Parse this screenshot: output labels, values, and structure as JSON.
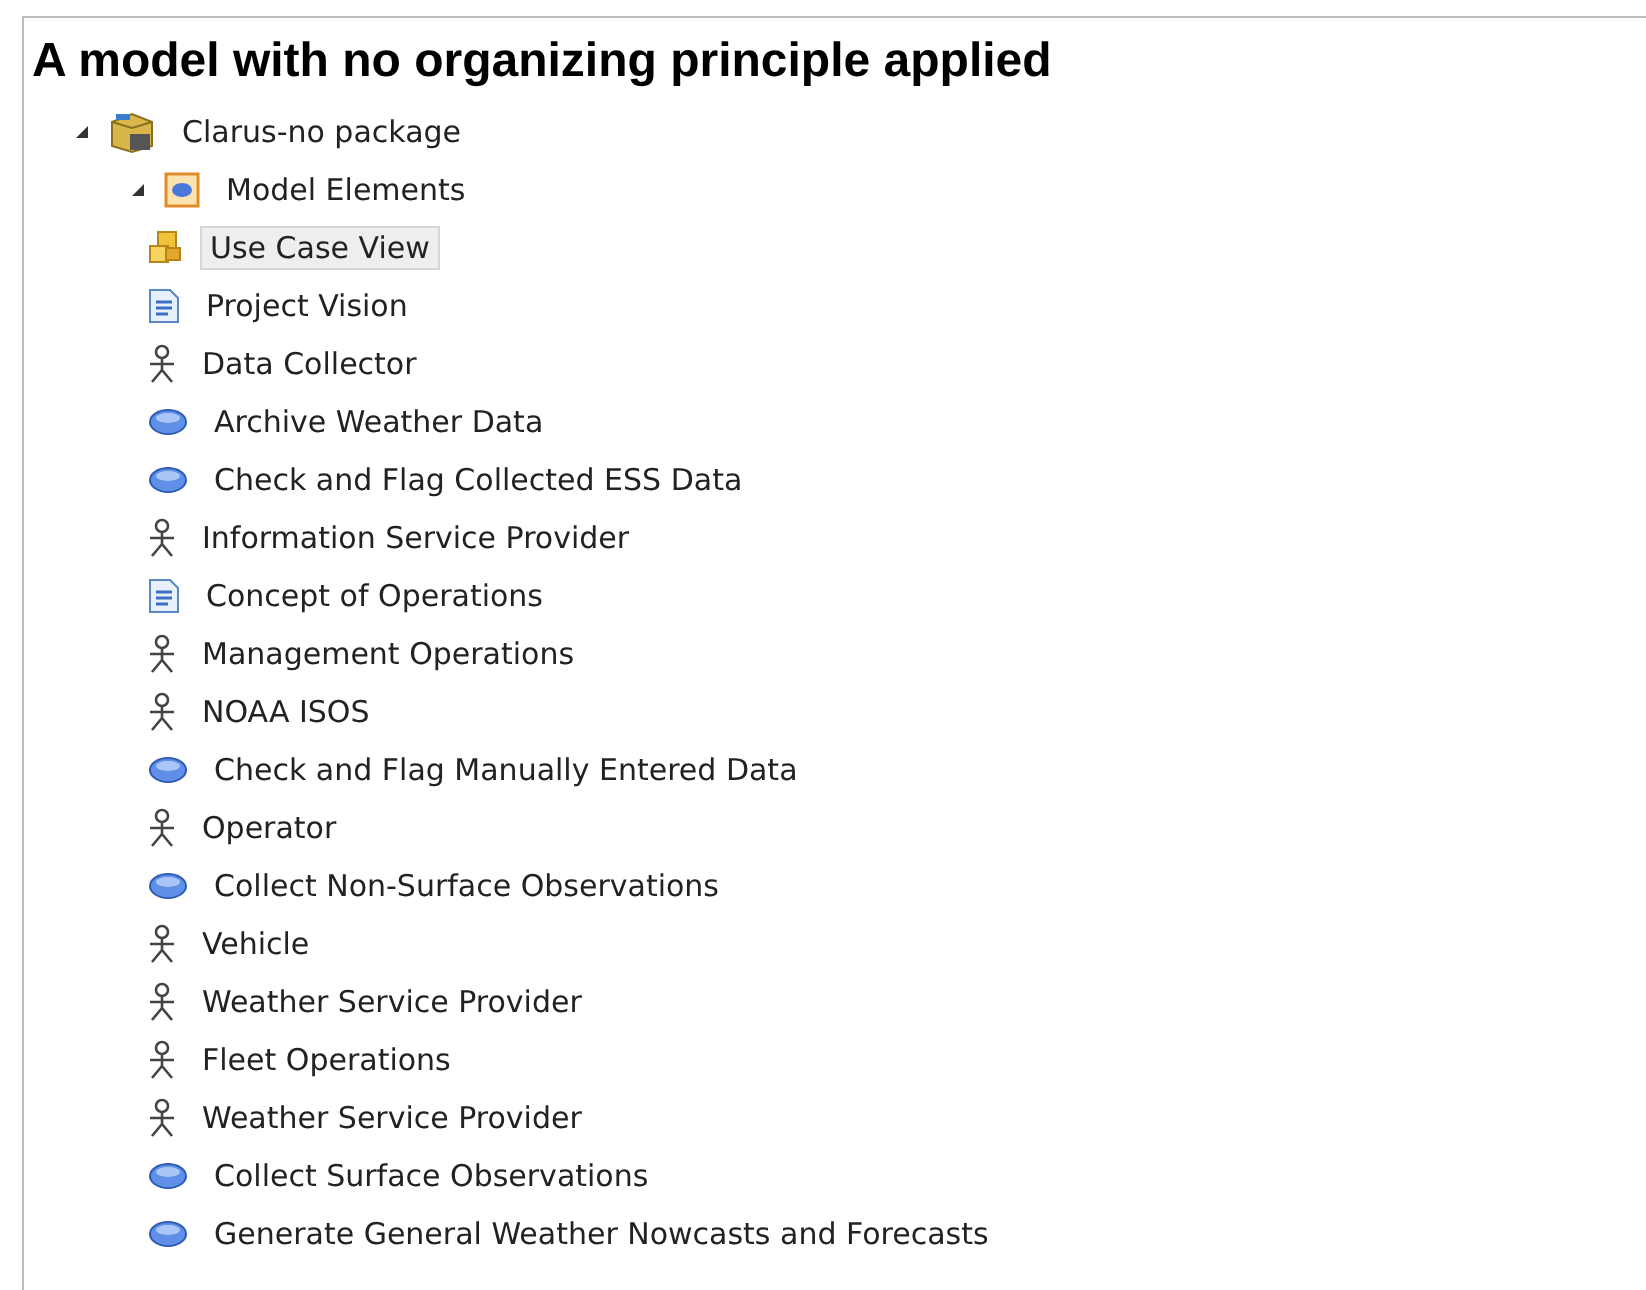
{
  "title": "A model with no organizing principle applied",
  "tree": [
    {
      "label": "Clarus-no package",
      "kind": "package",
      "expanded": true,
      "selected": false,
      "children": [
        {
          "label": "Model Elements",
          "kind": "model",
          "expanded": true,
          "selected": false,
          "children": [
            {
              "label": "Use Case View",
              "kind": "view",
              "selected": true
            },
            {
              "label": "Project Vision",
              "kind": "document",
              "selected": false
            },
            {
              "label": "Data Collector",
              "kind": "actor",
              "selected": false
            },
            {
              "label": "Archive Weather Data",
              "kind": "usecase",
              "selected": false
            },
            {
              "label": "Check and Flag Collected ESS Data",
              "kind": "usecase",
              "selected": false
            },
            {
              "label": "Information Service Provider",
              "kind": "actor",
              "selected": false
            },
            {
              "label": "Concept of Operations",
              "kind": "document",
              "selected": false
            },
            {
              "label": "Management Operations",
              "kind": "actor",
              "selected": false
            },
            {
              "label": "NOAA ISOS",
              "kind": "actor",
              "selected": false
            },
            {
              "label": "Check and Flag Manually Entered Data",
              "kind": "usecase",
              "selected": false
            },
            {
              "label": "Operator",
              "kind": "actor",
              "selected": false
            },
            {
              "label": "Collect Non-Surface Observations",
              "kind": "usecase",
              "selected": false
            },
            {
              "label": "Vehicle",
              "kind": "actor",
              "selected": false
            },
            {
              "label": "Weather Service Provider",
              "kind": "actor",
              "selected": false
            },
            {
              "label": "Fleet Operations",
              "kind": "actor",
              "selected": false
            },
            {
              "label": "Weather Service Provider",
              "kind": "actor",
              "selected": false
            },
            {
              "label": "Collect Surface Observations",
              "kind": "usecase",
              "selected": false
            },
            {
              "label": "Generate General Weather Nowcasts and Forecasts",
              "kind": "usecase",
              "selected": false
            }
          ]
        }
      ]
    }
  ]
}
